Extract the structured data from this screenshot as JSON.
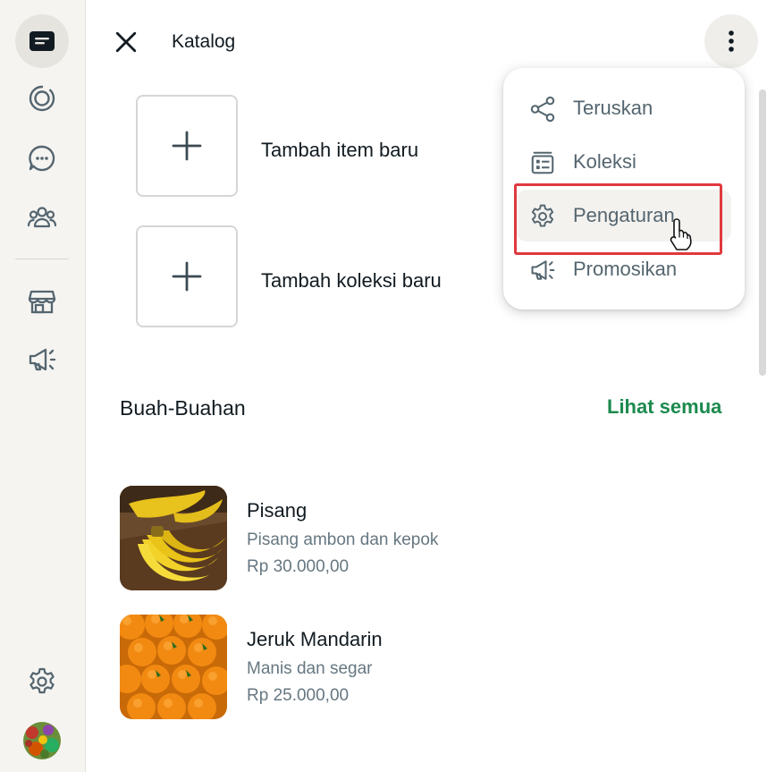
{
  "header": {
    "title": "Katalog"
  },
  "sidebar": {
    "items": [
      {
        "icon": "chats-icon",
        "active": true
      },
      {
        "icon": "status-icon"
      },
      {
        "icon": "channels-icon"
      },
      {
        "icon": "communities-icon"
      },
      {
        "icon": "store-icon"
      },
      {
        "icon": "megaphone-icon"
      },
      {
        "icon": "settings-icon"
      },
      {
        "icon": "profile-avatar"
      }
    ]
  },
  "actions": {
    "add_item": "Tambah item baru",
    "add_collection": "Tambah koleksi baru"
  },
  "section": {
    "title": "Buah-Buahan",
    "see_all": "Lihat semua"
  },
  "products": [
    {
      "name": "Pisang",
      "description": "Pisang ambon dan kepok",
      "price": "Rp 30.000,00"
    },
    {
      "name": "Jeruk Mandarin",
      "description": "Manis dan segar",
      "price": "Rp 25.000,00"
    }
  ],
  "menu": {
    "items": [
      {
        "label": "Teruskan",
        "icon": "share-icon"
      },
      {
        "label": "Koleksi",
        "icon": "collection-icon"
      },
      {
        "label": "Pengaturan",
        "icon": "gear-icon",
        "highlighted": true
      },
      {
        "label": "Promosikan",
        "icon": "megaphone-icon"
      }
    ]
  },
  "colors": {
    "accent_green": "#1c8a4e",
    "highlight_red": "#e0393e",
    "rail_bg": "#f5f4f1"
  }
}
